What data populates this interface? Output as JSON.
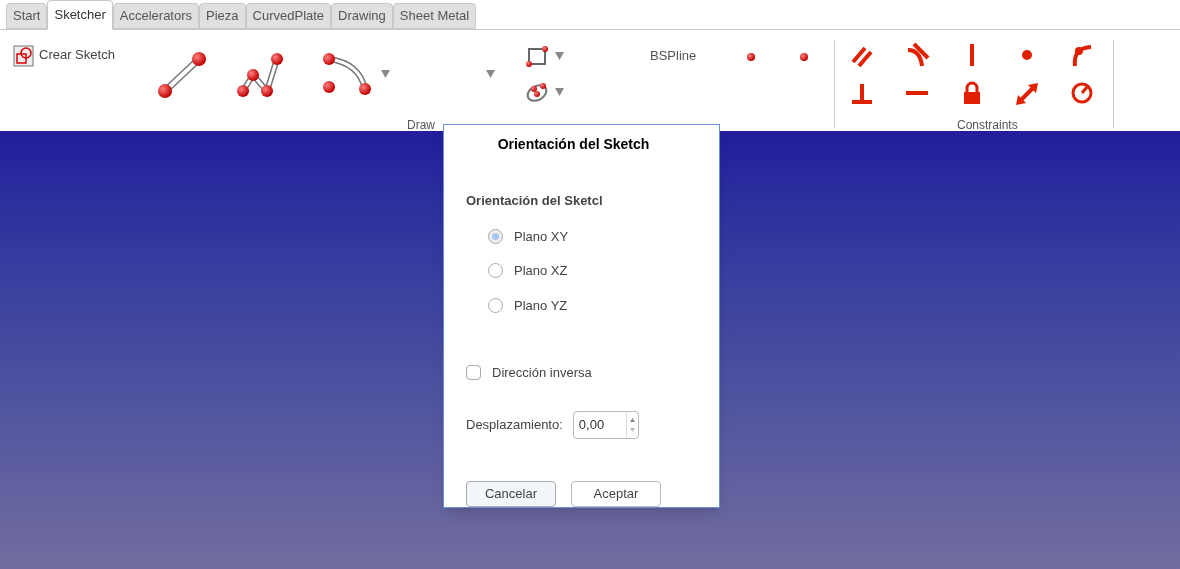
{
  "tabs": [
    {
      "label": "Start",
      "selected": false
    },
    {
      "label": "Sketcher",
      "selected": true
    },
    {
      "label": "Accelerators",
      "selected": false
    },
    {
      "label": "Pieza",
      "selected": false
    },
    {
      "label": "CurvedPlate",
      "selected": false
    },
    {
      "label": "Drawing",
      "selected": false
    },
    {
      "label": "Sheet Metal",
      "selected": false
    }
  ],
  "toolbar": {
    "create_sketch": "Crear Sketch",
    "bspline": "BSPline",
    "groups": [
      "Draw",
      "Constraints"
    ]
  },
  "dialog": {
    "title": "Orientación del Sketch",
    "section": "Orientación del Sketcl",
    "options": [
      {
        "label": "Plano XY",
        "selected": true
      },
      {
        "label": "Plano XZ",
        "selected": false
      },
      {
        "label": "Plano YZ",
        "selected": false
      }
    ],
    "reverse": {
      "label": "Dirección inversa",
      "checked": false
    },
    "offset": {
      "label": "Desplazamiento:",
      "value": "0,00"
    },
    "buttons": [
      "Cancelar",
      "Aceptar"
    ]
  }
}
